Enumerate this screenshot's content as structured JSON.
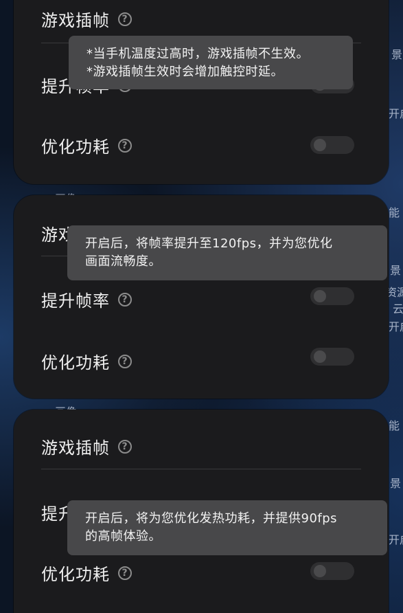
{
  "background_text": {
    "right_1": "景",
    "right_2": "开启",
    "mid_left": "画像",
    "right_3": "能",
    "right_4": "景",
    "right_5": "资源",
    "right_6": "云",
    "right_7": "开启",
    "bottom_left": "画像",
    "right_8": "能",
    "right_9": "景",
    "right_10": "开启"
  },
  "panels": [
    {
      "title": "游戏插帧",
      "row1": "提升帧率",
      "row2": "优化功耗",
      "tooltip": [
        "*当手机温度过高时，游戏插帧不生效。",
        "*游戏插帧生效时会增加触控时延。"
      ]
    },
    {
      "title": "游戏插帧",
      "row1": "提升帧率",
      "row2": "优化功耗",
      "tooltip": [
        "开启后，将帧率提升至120fps，并为您优化",
        "画面流畅度。"
      ]
    },
    {
      "title": "游戏插帧",
      "row1": "提升帧率",
      "row2": "优化功耗",
      "tooltip": [
        "开启后，将为您优化发热功耗，并提供90fps",
        "的高帧体验。"
      ]
    }
  ],
  "icons": {
    "help": "question-circle-icon"
  },
  "colors": {
    "panel_bg": "#1b1b1d",
    "tooltip_bg": "#48484a",
    "text": "#f0f0f0"
  }
}
